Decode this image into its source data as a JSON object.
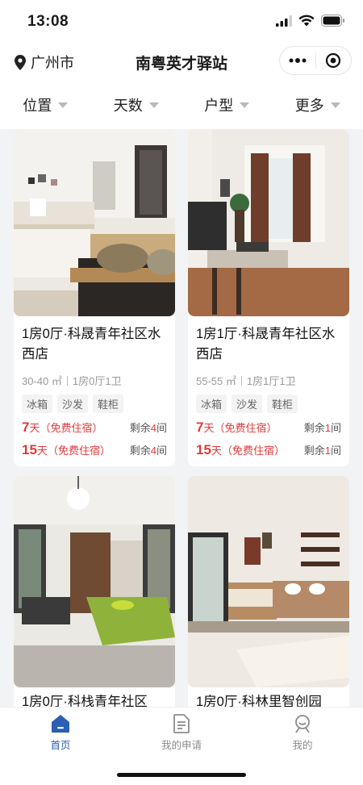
{
  "status": {
    "time": "13:08"
  },
  "nav": {
    "city": "广州市",
    "title": "南粤英才驿站"
  },
  "filters": [
    "位置",
    "天数",
    "户型",
    "更多"
  ],
  "listings": [
    {
      "title": "1房0厅·科晟青年社区水西店",
      "area": "30-40 ㎡",
      "layout": "1房0厅1卫",
      "tags": [
        "冰箱",
        "沙发",
        "鞋柜"
      ],
      "offers": [
        {
          "days": "7",
          "unit": "天",
          "note": "（免费住宿）",
          "remain_prefix": "剩余",
          "remain_num": "4",
          "remain_suffix": "间"
        },
        {
          "days": "15",
          "unit": "天",
          "note": "（免费住宿）",
          "remain_prefix": "剩余",
          "remain_num": "4",
          "remain_suffix": "间"
        }
      ]
    },
    {
      "title": "1房1厅·科晟青年社区水西店",
      "area": "55-55 ㎡",
      "layout": "1房1厅1卫",
      "tags": [
        "冰箱",
        "沙发",
        "鞋柜"
      ],
      "offers": [
        {
          "days": "7",
          "unit": "天",
          "note": "（免费住宿）",
          "remain_prefix": "剩余",
          "remain_num": "1",
          "remain_suffix": "间"
        },
        {
          "days": "15",
          "unit": "天",
          "note": "（免费住宿）",
          "remain_prefix": "剩余",
          "remain_num": "1",
          "remain_suffix": "间"
        }
      ]
    },
    {
      "title": "1房0厅·科栈青年社区"
    },
    {
      "title": "1房0厅·科林里智创园"
    }
  ],
  "tabbar": [
    {
      "label": "首页",
      "icon": "home-icon",
      "active": true
    },
    {
      "label": "我的申请",
      "icon": "document-icon",
      "active": false
    },
    {
      "label": "我的",
      "icon": "user-icon",
      "active": false
    }
  ],
  "colors": {
    "accent": "#2b5fb3",
    "price_red": "#e23a3a"
  }
}
